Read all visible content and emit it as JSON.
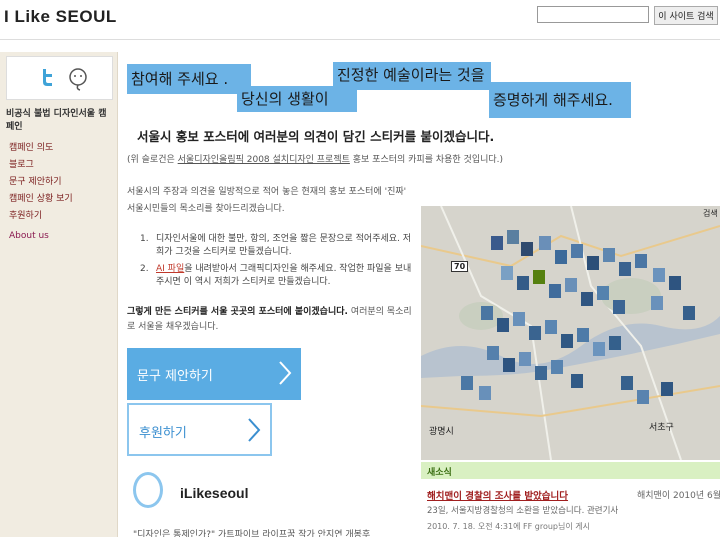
{
  "header": {
    "logo": "I Like SEOUL",
    "search_placeholder": "",
    "search_button": "이 사이트 검색"
  },
  "sidebar": {
    "heading": "비공식 불법 디자인서울 캠페인",
    "items": [
      {
        "label": "캠페인 의도"
      },
      {
        "label": "블로그"
      },
      {
        "label": "문구 제안하기"
      },
      {
        "label": "캠페인 상황 보기"
      },
      {
        "label": "후원하기"
      },
      {
        "label": "About us"
      }
    ]
  },
  "hero": {
    "line1": "참여해 주세요 .",
    "line2": "당신의 생활이",
    "line3": "진정한 예술이라는 것을",
    "line4": "증명하게 해주세요."
  },
  "intro": {
    "title": "서울시 홍보 포스터에 여러분의 의견이 담긴 스티커를 붙이겠습니다.",
    "note_prefix": "(위 슬로건은 ",
    "note_link": "서울디자인올림픽 2008 설치디자인 프로젝트",
    "note_suffix": " 홍보 포스터의 카피를 차용한 것입니다.)"
  },
  "description": "서울시의 주장과 의견을 일방적으로 적어 놓은 현재의 홍보 포스터에 '진짜' 서울시민들의 목소리를 찾아드리겠습니다.",
  "steps": [
    {
      "num": "1.",
      "text": "디자인서울에 대한 불만, 항의, 조언을 짧은 문장으로 적어주세요. 저희가 그것을 스티커로 만들겠습니다."
    },
    {
      "num": "2.",
      "link": "AI 파일",
      "text": "을 내려받아서 그래픽디자인을 해주세요. 작업한 파일을 보내주시면 이 역시 저희가 스티커로 만들겠습니다."
    }
  ],
  "closing": {
    "strong": "그렇게 만든 스티커를 서울 곳곳의 포스터에 붙이겠습니다.",
    "rest": " 여러분의 목소리로 서울을 채우겠습니다."
  },
  "cta": {
    "suggest": "문구 제안하기",
    "support": "후원하기"
  },
  "profile": {
    "name": "iLikeseoul",
    "text": "\"디자인은 통제인가?\" 가트파이브 라이프꿈 작가 안지연 개봉후"
  },
  "map": {
    "label_gwangmyeong": "광명시",
    "label_seocho": "서초구",
    "label_search": "검색",
    "road_number": "70"
  },
  "news": {
    "heading": "새소식",
    "title": "해치맨이 경찰의 조사를 받았습니다",
    "inline_date": "해치맨이 2010년 6월",
    "body": "23일, 서울지방경찰청의 소환을 받았습니다. 관련기사",
    "meta": "2010. 7. 18. 오전 4:31에 FF group님이 게시"
  },
  "colors": {
    "accent_blue": "#5aace3",
    "hero_blue": "#6cb3e6",
    "sidebar_bg": "#f1ece1",
    "link_red": "#a01e1e",
    "news_green": "#d9f0c2"
  }
}
